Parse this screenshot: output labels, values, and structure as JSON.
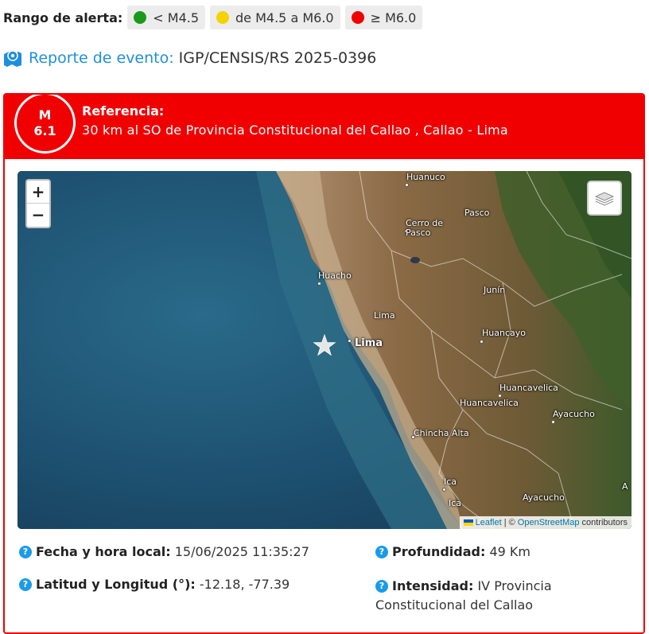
{
  "alert_range": {
    "title": "Rango de alerta:",
    "levels": [
      {
        "label": "< M4.5",
        "color": "#1a9a1a"
      },
      {
        "label": "de M4.5 a M6.0",
        "color": "#f6d200"
      },
      {
        "label": "≥ M6.0",
        "color": "#f00000"
      }
    ]
  },
  "report": {
    "label": "Reporte de evento:",
    "code": "IGP/CENSIS/RS 2025-0396",
    "icon": "map-marker-icon"
  },
  "event": {
    "mag_prefix": "M",
    "magnitude": "6.1",
    "reference_title": "Referencia:",
    "reference": "30 km al SO de Provincia Constitucional del Callao , Callao - Lima",
    "color": "#f00000"
  },
  "map": {
    "zoom_in": "+",
    "zoom_out": "−",
    "cities": [
      "Huanuco",
      "Pasco",
      "Cerro de",
      "Pasco",
      "Huacho",
      "Junín",
      "Lima",
      "Lima",
      "Huancayo",
      "Huancavelica",
      "Huancavelica",
      "Ayacucho",
      "Chincha Alta",
      "Ica",
      "Ica",
      "Ayacucho",
      "A"
    ],
    "attribution": {
      "leaflet": "Leaflet",
      "sep": "| ©",
      "osm": "OpenStreetMap",
      "rest": "contributors"
    }
  },
  "details": {
    "datetime_label": "Fecha y hora local:",
    "datetime": "15/06/2025 11:35:27",
    "coords_label": "Latitud y Longitud (°):",
    "coords": "-12.18, -77.39",
    "depth_label": "Profundidad:",
    "depth": "49 Km",
    "intensity_label": "Intensidad:",
    "intensity_line1": "IV Provincia",
    "intensity_line2": "Constitucional del Callao"
  }
}
